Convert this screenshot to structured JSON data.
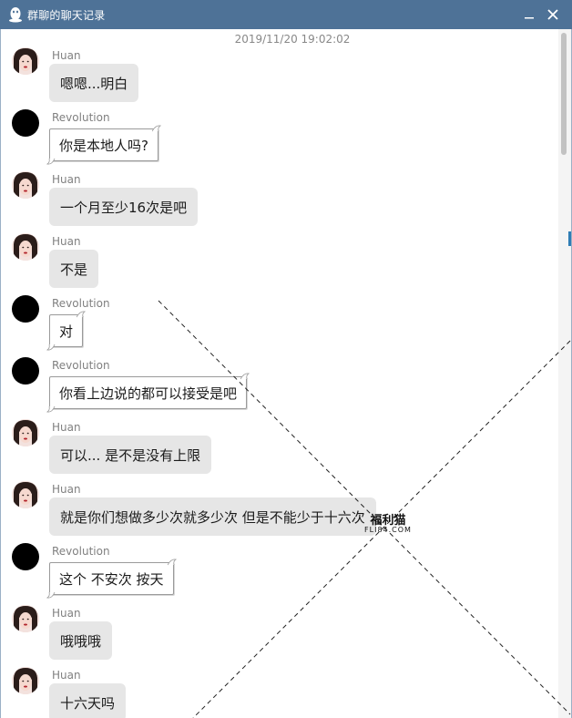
{
  "window": {
    "title": "群聊的聊天记录",
    "icon": "qq-penguin-icon",
    "minimize_icon": "minimize-icon",
    "close_icon": "close-icon"
  },
  "chat": {
    "timestamp": "2019/11/20 19:02:02",
    "messages": [
      {
        "sender": "Huan",
        "text": "嗯嗯...明白",
        "style": "grey"
      },
      {
        "sender": "Revolution",
        "text": "你是本地人吗?",
        "style": "paper"
      },
      {
        "sender": "Huan",
        "text": "一个月至少16次是吧",
        "style": "grey"
      },
      {
        "sender": "Huan",
        "text": "不是",
        "style": "grey"
      },
      {
        "sender": "Revolution",
        "text": "对",
        "style": "paper"
      },
      {
        "sender": "Revolution",
        "text": "你看上边说的都可以接受是吧",
        "style": "paper"
      },
      {
        "sender": "Huan",
        "text": "可以... 是不是没有上限",
        "style": "grey"
      },
      {
        "sender": "Huan",
        "text": "就是你们想做多少次就多少次 但是不能少于十六次",
        "style": "grey"
      },
      {
        "sender": "Revolution",
        "text": "这个 不安次 按天",
        "style": "paper"
      },
      {
        "sender": "Huan",
        "text": "哦哦哦",
        "style": "grey"
      },
      {
        "sender": "Huan",
        "text": "十六天吗",
        "style": "grey"
      }
    ]
  },
  "watermark": {
    "cn": "福利猫",
    "en": "FLI84.COM"
  },
  "colors": {
    "titlebar": "#4e7297",
    "bubble_grey": "#e6e6e6",
    "sender_text": "#808080"
  }
}
